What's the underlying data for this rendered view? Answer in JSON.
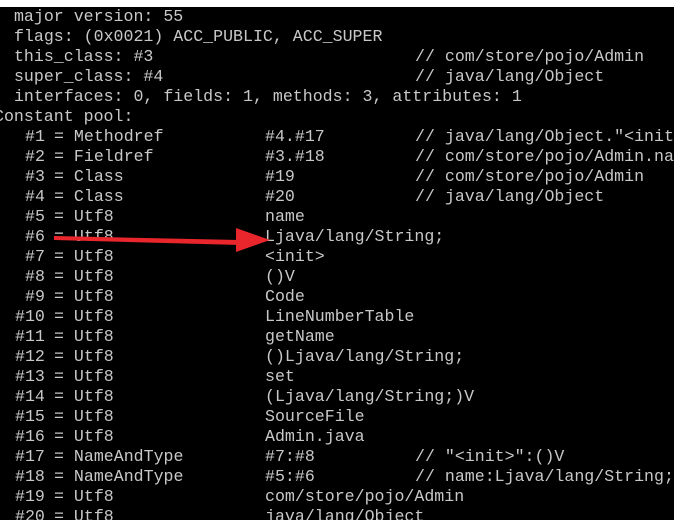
{
  "header_lines": [
    {
      "text": " major version: 55",
      "comment": ""
    },
    {
      "text": " flags: (0x0021) ACC_PUBLIC, ACC_SUPER",
      "comment": ""
    },
    {
      "text": " this_class: #3",
      "comment": "// com/store/pojo/Admin"
    },
    {
      "text": " super_class: #4",
      "comment": "// java/lang/Object"
    },
    {
      "text": " interfaces: 0, fields: 1, methods: 3, attributes: 1",
      "comment": ""
    },
    {
      "text": "Constant pool:",
      "comment": ""
    }
  ],
  "constant_pool": [
    {
      "index": "#1",
      "type": "= Methodref",
      "value": "#4.#17",
      "comment": "// java/lang/Object.\"<init"
    },
    {
      "index": "#2",
      "type": "= Fieldref",
      "value": "#3.#18",
      "comment": "// com/store/pojo/Admin.na"
    },
    {
      "index": "#3",
      "type": "= Class",
      "value": "#19",
      "comment": "// com/store/pojo/Admin"
    },
    {
      "index": "#4",
      "type": "= Class",
      "value": "#20",
      "comment": "// java/lang/Object"
    },
    {
      "index": "#5",
      "type": "= Utf8",
      "value": "name",
      "comment": ""
    },
    {
      "index": "#6",
      "type": "= Utf8",
      "value": "Ljava/lang/String;",
      "comment": ""
    },
    {
      "index": "#7",
      "type": "= Utf8",
      "value": "<init>",
      "comment": ""
    },
    {
      "index": "#8",
      "type": "= Utf8",
      "value": "()V",
      "comment": ""
    },
    {
      "index": "#9",
      "type": "= Utf8",
      "value": "Code",
      "comment": ""
    },
    {
      "index": "#10",
      "type": "= Utf8",
      "value": "LineNumberTable",
      "comment": ""
    },
    {
      "index": "#11",
      "type": "= Utf8",
      "value": "getName",
      "comment": ""
    },
    {
      "index": "#12",
      "type": "= Utf8",
      "value": "()Ljava/lang/String;",
      "comment": ""
    },
    {
      "index": "#13",
      "type": "= Utf8",
      "value": "set",
      "comment": ""
    },
    {
      "index": "#14",
      "type": "= Utf8",
      "value": "(Ljava/lang/String;)V",
      "comment": ""
    },
    {
      "index": "#15",
      "type": "= Utf8",
      "value": "SourceFile",
      "comment": ""
    },
    {
      "index": "#16",
      "type": "= Utf8",
      "value": "Admin.java",
      "comment": ""
    },
    {
      "index": "#17",
      "type": "= NameAndType",
      "value": "#7:#8",
      "comment": "// \"<init>\":()V"
    },
    {
      "index": "#18",
      "type": "= NameAndType",
      "value": "#5:#6",
      "comment": "// name:Ljava/lang/String;"
    },
    {
      "index": "#19",
      "type": "= Utf8",
      "value": "com/store/pojo/Admin",
      "comment": ""
    },
    {
      "index": "#20",
      "type": "= Utf8",
      "value": "java/lang/Object",
      "comment": ""
    }
  ],
  "annotation": {
    "type": "arrow",
    "color": "#e8262b",
    "from_entry": "#6",
    "points_to": "Ljava/lang/String;"
  },
  "colors": {
    "background": "#000000",
    "text": "#c8c8c8",
    "top_strip": "#ffffff"
  }
}
